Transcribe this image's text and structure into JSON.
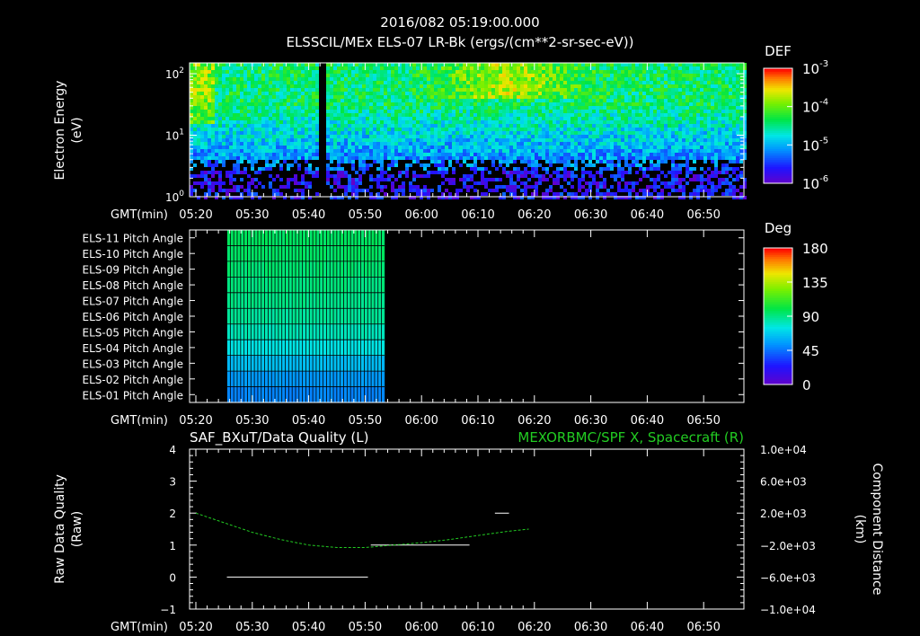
{
  "header": {
    "timestamp": "2016/082 05:19:00.000",
    "subtitle": "ELSSCIL/MEx ELS-07 LR-Bk  (ergs/(cm**2-sr-sec-eV))"
  },
  "colors": {
    "background": "#000000",
    "axes": "#ffffff",
    "right_series": "#22cc22",
    "right_title": "#22cc22"
  },
  "chart_data": [
    {
      "type": "heatmap",
      "name": "energy-spectrogram",
      "ylabel": "Electron Energy (eV)",
      "ylabel_lines": [
        "Electron Energy",
        "(eV)"
      ],
      "yscale": "log",
      "ylim": [
        1,
        150
      ],
      "yticks": [
        {
          "value": 1,
          "base": "10",
          "exp": "0"
        },
        {
          "value": 10,
          "base": "10",
          "exp": "1"
        },
        {
          "value": 100,
          "base": "10",
          "exp": "2"
        }
      ],
      "x_prefix": "GMT(min)",
      "xlim_min": [
        0,
        38
      ],
      "xticks": [
        "05:20",
        "05:30",
        "05:40",
        "05:50",
        "06:00",
        "06:10",
        "06:20",
        "06:30",
        "06:40",
        "06:50"
      ],
      "colorbar": {
        "title": "DEF",
        "scale": "log",
        "range": [
          1e-06,
          0.001
        ],
        "ticks": [
          {
            "value": 0.001,
            "base": "10",
            "exp": "-3"
          },
          {
            "value": 0.0001,
            "base": "10",
            "exp": "-4"
          },
          {
            "value": 1e-05,
            "base": "10",
            "exp": "-5"
          },
          {
            "value": 1e-06,
            "base": "10",
            "exp": "-6"
          }
        ]
      },
      "data_gaps_min": [
        [
          21.5,
          23.0
        ]
      ]
    },
    {
      "type": "heatmap",
      "name": "pitch-angle-grid",
      "row_labels": [
        "ELS-11 Pitch Angle",
        "ELS-10 Pitch Angle",
        "ELS-09 Pitch Angle",
        "ELS-08 Pitch Angle",
        "ELS-07 Pitch Angle",
        "ELS-06 Pitch Angle",
        "ELS-05 Pitch Angle",
        "ELS-04 Pitch Angle",
        "ELS-03 Pitch Angle",
        "ELS-02 Pitch Angle",
        "ELS-01 Pitch Angle"
      ],
      "row_values_deg": [
        105,
        104,
        102,
        100,
        98,
        95,
        90,
        82,
        70,
        60,
        55
      ],
      "data_range_min": [
        5.5,
        33.5
      ],
      "x_prefix": "GMT(min)",
      "xticks": [
        "05:20",
        "05:30",
        "05:40",
        "05:50",
        "06:00",
        "06:10",
        "06:20",
        "06:30",
        "06:40",
        "06:50"
      ],
      "colorbar": {
        "title": "Deg",
        "range": [
          0,
          180
        ],
        "ticks": [
          "180",
          "135",
          "90",
          "45",
          "0"
        ]
      }
    },
    {
      "type": "line",
      "name": "data-quality",
      "title_left": "SAF_BXuT/Data Quality (L)",
      "title_right": "MEXORBMC/SPF X, Spacecraft (R)",
      "ylabel_left_lines": [
        "Raw Data Quality",
        "(Raw)"
      ],
      "ylabel_right_lines": [
        "Component Distance",
        "(km)"
      ],
      "ylim_left": [
        -1,
        4
      ],
      "yticks_left": [
        "4",
        "3",
        "2",
        "1",
        "0",
        "−1"
      ],
      "ylim_right": [
        -10000,
        10000
      ],
      "yticks_right": [
        "1.0e+04",
        "6.0e+03",
        "2.0e+03",
        "−2.0e+03",
        "−6.0e+03",
        "−1.0e+04"
      ],
      "x_prefix": "GMT(min)",
      "xticks": [
        "05:20",
        "05:30",
        "05:40",
        "05:50",
        "06:00",
        "06:10",
        "06:20",
        "06:30",
        "06:40",
        "06:50"
      ],
      "series": [
        {
          "axis": "left",
          "segments": [
            {
              "x_min": [
                5.5,
                30.5
              ],
              "y": 0
            },
            {
              "x_min": [
                31.0,
                48.5
              ],
              "y": 1
            },
            {
              "x_min": [
                53.0,
                55.5
              ],
              "y": 2
            }
          ]
        },
        {
          "axis": "right",
          "x_min": [
            0,
            5,
            10,
            15,
            20,
            25,
            30,
            35,
            40,
            45,
            50,
            55,
            59
          ],
          "y_km": [
            2000,
            800,
            -400,
            -1300,
            -2000,
            -2300,
            -2300,
            -2000,
            -1700,
            -1300,
            -800,
            -300,
            0
          ]
        }
      ]
    }
  ]
}
